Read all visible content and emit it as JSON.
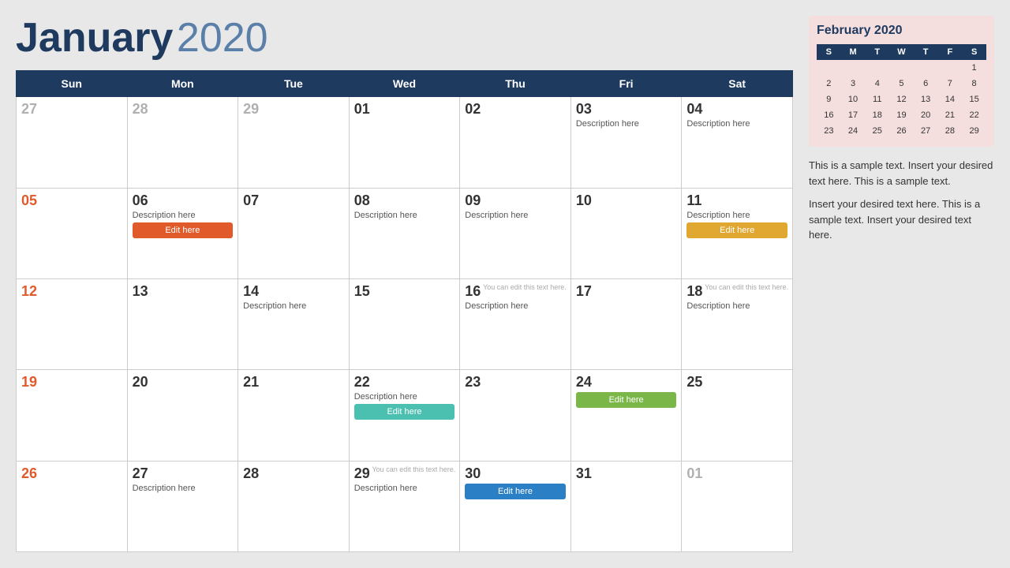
{
  "header": {
    "month": "January",
    "year": "2020"
  },
  "weekdays": [
    "Sun",
    "Mon",
    "Tue",
    "Wed",
    "Thu",
    "Fri",
    "Sat"
  ],
  "weeks": [
    [
      {
        "num": "27",
        "type": "gray",
        "desc": "",
        "btn": null,
        "note": null
      },
      {
        "num": "28",
        "type": "gray",
        "desc": "",
        "btn": null,
        "note": null
      },
      {
        "num": "29",
        "type": "gray",
        "desc": "",
        "btn": null,
        "note": null
      },
      {
        "num": "01",
        "type": "normal",
        "desc": "",
        "btn": null,
        "note": null
      },
      {
        "num": "02",
        "type": "normal",
        "desc": "",
        "btn": null,
        "note": null
      },
      {
        "num": "03",
        "type": "normal",
        "desc": "Description here",
        "btn": null,
        "note": null
      },
      {
        "num": "04",
        "type": "normal",
        "desc": "Description here",
        "btn": null,
        "note": null
      }
    ],
    [
      {
        "num": "05",
        "type": "red",
        "desc": "",
        "btn": null,
        "note": null
      },
      {
        "num": "06",
        "type": "normal",
        "desc": "Description here",
        "btn": {
          "label": "Edit here",
          "color": "orange"
        },
        "note": null
      },
      {
        "num": "07",
        "type": "normal",
        "desc": "",
        "btn": null,
        "note": null
      },
      {
        "num": "08",
        "type": "normal",
        "desc": "Description here",
        "btn": null,
        "note": null
      },
      {
        "num": "09",
        "type": "normal",
        "desc": "Description here",
        "btn": null,
        "note": null
      },
      {
        "num": "10",
        "type": "normal",
        "desc": "",
        "btn": null,
        "note": null
      },
      {
        "num": "11",
        "type": "normal",
        "desc": "Description here",
        "btn": {
          "label": "Edit here",
          "color": "amber"
        },
        "note": null
      }
    ],
    [
      {
        "num": "12",
        "type": "red",
        "desc": "",
        "btn": null,
        "note": null
      },
      {
        "num": "13",
        "type": "normal",
        "desc": "",
        "btn": null,
        "note": null
      },
      {
        "num": "14",
        "type": "normal",
        "desc": "Description here",
        "btn": null,
        "note": null
      },
      {
        "num": "15",
        "type": "normal",
        "desc": "",
        "btn": null,
        "note": null
      },
      {
        "num": "16",
        "type": "normal",
        "desc": "Description here",
        "btn": null,
        "note": "You can edit this text here."
      },
      {
        "num": "17",
        "type": "normal",
        "desc": "",
        "btn": null,
        "note": null
      },
      {
        "num": "18",
        "type": "normal",
        "desc": "Description here",
        "btn": null,
        "note": "You can edit this text here."
      }
    ],
    [
      {
        "num": "19",
        "type": "red",
        "desc": "",
        "btn": null,
        "note": null
      },
      {
        "num": "20",
        "type": "normal",
        "desc": "",
        "btn": null,
        "note": null
      },
      {
        "num": "21",
        "type": "normal",
        "desc": "",
        "btn": null,
        "note": null
      },
      {
        "num": "22",
        "type": "normal",
        "desc": "Description here",
        "btn": {
          "label": "Edit here",
          "color": "teal"
        },
        "note": null
      },
      {
        "num": "23",
        "type": "normal",
        "desc": "",
        "btn": null,
        "note": null
      },
      {
        "num": "24",
        "type": "normal",
        "desc": "",
        "btn": {
          "label": "Edit here",
          "color": "green"
        },
        "note": null
      },
      {
        "num": "25",
        "type": "normal",
        "desc": "",
        "btn": null,
        "note": null
      }
    ],
    [
      {
        "num": "26",
        "type": "red",
        "desc": "",
        "btn": null,
        "note": null
      },
      {
        "num": "27",
        "type": "normal",
        "desc": "Description here",
        "btn": null,
        "note": null
      },
      {
        "num": "28",
        "type": "normal",
        "desc": "",
        "btn": null,
        "note": null
      },
      {
        "num": "29",
        "type": "normal",
        "desc": "Description here",
        "btn": null,
        "note": "You can edit this text here."
      },
      {
        "num": "30",
        "type": "normal",
        "desc": "",
        "btn": {
          "label": "Edit here",
          "color": "blue"
        },
        "note": null
      },
      {
        "num": "31",
        "type": "normal",
        "desc": "",
        "btn": null,
        "note": null
      },
      {
        "num": "01",
        "type": "gray",
        "desc": "",
        "btn": null,
        "note": null
      }
    ]
  ],
  "sidebar": {
    "mini_title": "February 2020",
    "mini_days": [
      "S",
      "M",
      "T",
      "W",
      "T",
      "F",
      "S"
    ],
    "mini_weeks": [
      [
        "",
        "",
        "",
        "",
        "",
        "",
        "1"
      ],
      [
        "2",
        "3",
        "4",
        "5",
        "6",
        "7",
        "8"
      ],
      [
        "9",
        "10",
        "11",
        "12",
        "13",
        "14",
        "15"
      ],
      [
        "16",
        "17",
        "18",
        "19",
        "20",
        "21",
        "22"
      ],
      [
        "23",
        "24",
        "25",
        "26",
        "27",
        "28",
        "29"
      ]
    ],
    "text1": "This is a sample text. Insert your desired text here. This is a sample text.",
    "text2": "Insert your desired text here. This is a sample text. Insert your desired text here."
  },
  "edit_label": "Edit here"
}
